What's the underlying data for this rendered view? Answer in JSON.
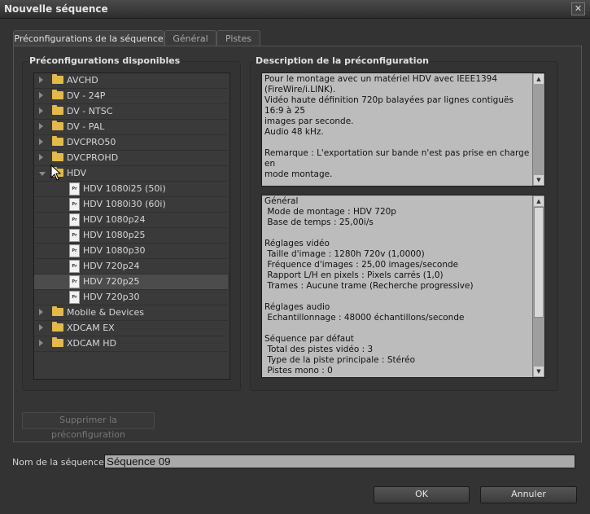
{
  "window": {
    "title": "Nouvelle séquence",
    "close_label": "✕"
  },
  "tabs": [
    {
      "label": "Préconfigurations de la séquence",
      "active": true
    },
    {
      "label": "Général",
      "active": false
    },
    {
      "label": "Pistes",
      "active": false
    }
  ],
  "presets": {
    "title": "Préconfigurations disponibles",
    "items": [
      {
        "label": "AVCHD",
        "type": "folder",
        "expanded": false
      },
      {
        "label": "DV - 24P",
        "type": "folder",
        "expanded": false
      },
      {
        "label": "DV - NTSC",
        "type": "folder",
        "expanded": false
      },
      {
        "label": "DV - PAL",
        "type": "folder",
        "expanded": false
      },
      {
        "label": "DVCPRO50",
        "type": "folder",
        "expanded": false
      },
      {
        "label": "DVCPROHD",
        "type": "folder",
        "expanded": false
      },
      {
        "label": "HDV",
        "type": "folder",
        "expanded": true
      },
      {
        "label": "HDV 1080i25 (50i)",
        "type": "file"
      },
      {
        "label": "HDV 1080i30 (60i)",
        "type": "file"
      },
      {
        "label": "HDV 1080p24",
        "type": "file"
      },
      {
        "label": "HDV 1080p25",
        "type": "file"
      },
      {
        "label": "HDV 1080p30",
        "type": "file"
      },
      {
        "label": "HDV 720p24",
        "type": "file"
      },
      {
        "label": "HDV 720p25",
        "type": "file",
        "selected": true
      },
      {
        "label": "HDV 720p30",
        "type": "file"
      },
      {
        "label": "Mobile & Devices",
        "type": "folder",
        "expanded": false
      },
      {
        "label": "XDCAM EX",
        "type": "folder",
        "expanded": false
      },
      {
        "label": "XDCAM HD",
        "type": "folder",
        "expanded": false
      }
    ],
    "file_icon_text": "Pr"
  },
  "description": {
    "title": "Description de la préconfiguration",
    "text": "Pour le montage avec un matériel HDV avec IEEE1394\n(FireWire/i.LINK).\nVidéo haute définition 720p balayées par lignes contiguës 16:9 à 25\nimages par seconde.\nAudio 48 kHz.\n\nRemarque : L'exportation sur bande n'est pas prise en charge en\nmode montage."
  },
  "details": {
    "text": "Général\n Mode de montage : HDV 720p\n Base de temps : 25,00i/s\n\nRéglages vidéo\n Taille d'image : 1280h 720v (1,0000)\n Fréquence d'images : 25,00 images/seconde\n Rapport L/H en pixels : Pixels carrés (1,0)\n Trames : Aucune trame (Recherche progressive)\n\nRéglages audio\n Echantillonnage : 48000 échantillons/seconde\n\nSéquence par défaut\n Total des pistes vidéo : 3\n Type de la piste principale : Stéréo\n Pistes mono : 0"
  },
  "delete_button": "Supprimer la préconfiguration",
  "sequence_name": {
    "label": "Nom de la séquence :",
    "value": "Séquence 09"
  },
  "buttons": {
    "ok": "OK",
    "cancel": "Annuler"
  }
}
